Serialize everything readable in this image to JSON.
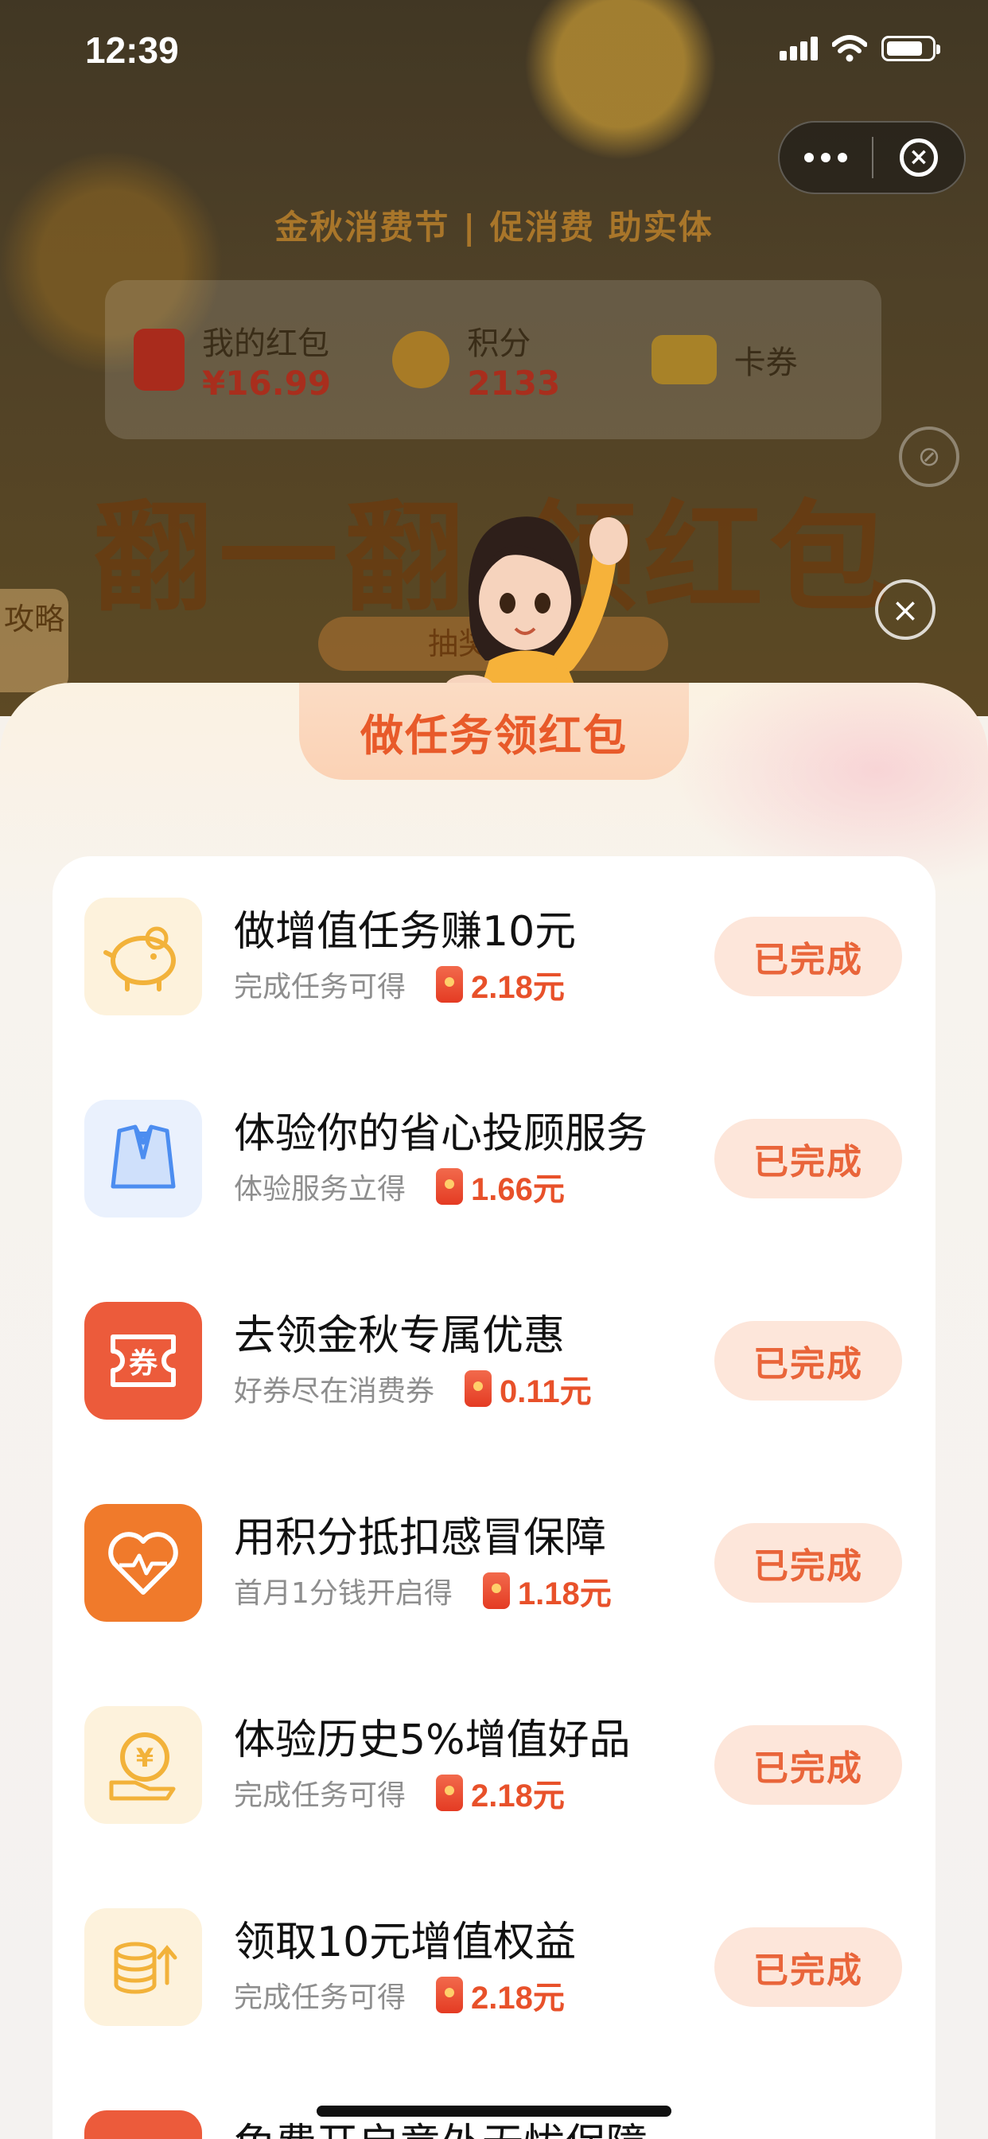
{
  "status_bar": {
    "time": "12:39"
  },
  "capsule": {
    "more_icon": "more-dots-icon",
    "close_icon": "close-circle-icon"
  },
  "background": {
    "festival_banner": "金秋消费节 | 促消费 助实体",
    "wallet": [
      {
        "label": "我的红包",
        "value": "¥16.99",
        "icon": "red-packet-icon"
      },
      {
        "label": "积分",
        "value": "2133",
        "icon": "points-icon"
      },
      {
        "label": "卡券",
        "value": "",
        "icon": "card-coupon-icon"
      }
    ],
    "hero_title": "翻一翻 领红包",
    "hero_subtitle": "抽奖砸 奖",
    "side_tab": "攻略"
  },
  "sheet": {
    "title": "做任务领红包",
    "tasks": [
      {
        "title": "做增值任务赚10元",
        "desc": "完成任务可得",
        "reward": "2.18元",
        "button": "已完成",
        "icon": "piggy-bank-icon",
        "icon_bg": "#fdf2dc"
      },
      {
        "title": "体验你的省心投顾服务",
        "desc": "体验服务立得",
        "reward": "1.66元",
        "button": "已完成",
        "icon": "vest-icon",
        "icon_bg": "#eaf1fd"
      },
      {
        "title": "去领金秋专属优惠",
        "desc": "好券尽在消费券",
        "reward": "0.11元",
        "button": "已完成",
        "icon": "coupon-icon",
        "icon_bg": "#ec5b3b"
      },
      {
        "title": "用积分抵扣感冒保障",
        "desc": "首月1分钱开启得",
        "reward": "1.18元",
        "button": "已完成",
        "icon": "heart-pulse-icon",
        "icon_bg": "#f07a2b"
      },
      {
        "title": "体验历史5%增值好品",
        "desc": "完成任务可得",
        "reward": "2.18元",
        "button": "已完成",
        "icon": "yen-hand-icon",
        "icon_bg": "#fdf2dc"
      },
      {
        "title": "领取10元增值权益",
        "desc": "完成任务可得",
        "reward": "2.18元",
        "button": "已完成",
        "icon": "coin-stack-icon",
        "icon_bg": "#fdf2dc"
      },
      {
        "title": "免费开启意外无忧保障",
        "desc": "",
        "reward": "",
        "button": "",
        "icon": "shield-icon",
        "icon_bg": "#ec5b3b"
      }
    ]
  }
}
